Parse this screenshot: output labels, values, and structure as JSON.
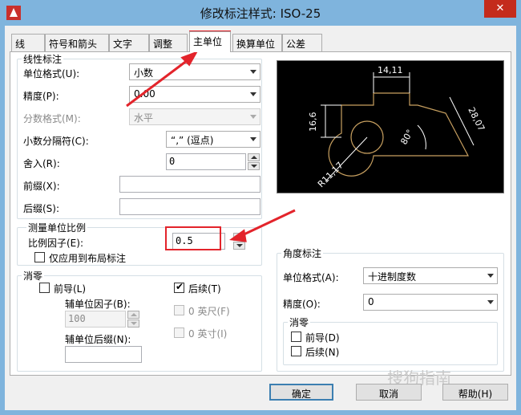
{
  "window": {
    "title": "修改标注样式: ISO-25",
    "close_glyph": "✕"
  },
  "tabs": [
    {
      "label": "线"
    },
    {
      "label": "符号和箭头"
    },
    {
      "label": "文字"
    },
    {
      "label": "调整"
    },
    {
      "label": "主单位",
      "active": true
    },
    {
      "label": "换算单位"
    },
    {
      "label": "公差"
    }
  ],
  "linear": {
    "group_title": "线性标注",
    "unit_format_label": "单位格式(U):",
    "unit_format_value": "小数",
    "precision_label": "精度(P):",
    "precision_value": "0.00",
    "fraction_format_label": "分数格式(M):",
    "fraction_format_value": "水平",
    "decimal_sep_label": "小数分隔符(C):",
    "decimal_sep_value": "“,” (逗点)",
    "roundoff_label": "舍入(R):",
    "roundoff_value": "0",
    "prefix_label": "前缀(X):",
    "prefix_value": "",
    "suffix_label": "后缀(S):",
    "suffix_value": ""
  },
  "scale": {
    "group_title": "测量单位比例",
    "factor_label": "比例因子(E):",
    "factor_value": "0.5",
    "layout_only_label": "仅应用到布局标注",
    "layout_only_checked": false
  },
  "zero_suppress": {
    "group_title": "消零",
    "leading_label": "前导(L)",
    "leading_checked": false,
    "trailing_label": "后续(T)",
    "trailing_checked": true,
    "sub_factor_label": "辅单位因子(B):",
    "sub_factor_value": "100",
    "sub_suffix_label": "辅单位后缀(N):",
    "sub_suffix_value": "",
    "feet_label": "0 英尺(F)",
    "inches_label": "0 英寸(I)"
  },
  "angular": {
    "group_title": "角度标注",
    "unit_format_label": "单位格式(A):",
    "unit_format_value": "十进制度数",
    "precision_label": "精度(O):",
    "precision_value": "0",
    "zero_title": "消零",
    "leading_label": "前导(D)",
    "trailing_label": "后续(N)"
  },
  "preview": {
    "dim_top": "14,11",
    "dim_left": "16,6",
    "dim_right": "28,07",
    "dim_angle": "80°",
    "dim_radius": "R11,17",
    "line_color": "#ffffff",
    "shape_color": "#c8a060"
  },
  "buttons": {
    "ok": "确定",
    "cancel": "取消",
    "help": "帮助(H)"
  },
  "watermark": "搜狗指南",
  "colors": {
    "titlebar": "#7fb4dd",
    "highlight": "#e3242b",
    "close": "#c42b1c"
  }
}
